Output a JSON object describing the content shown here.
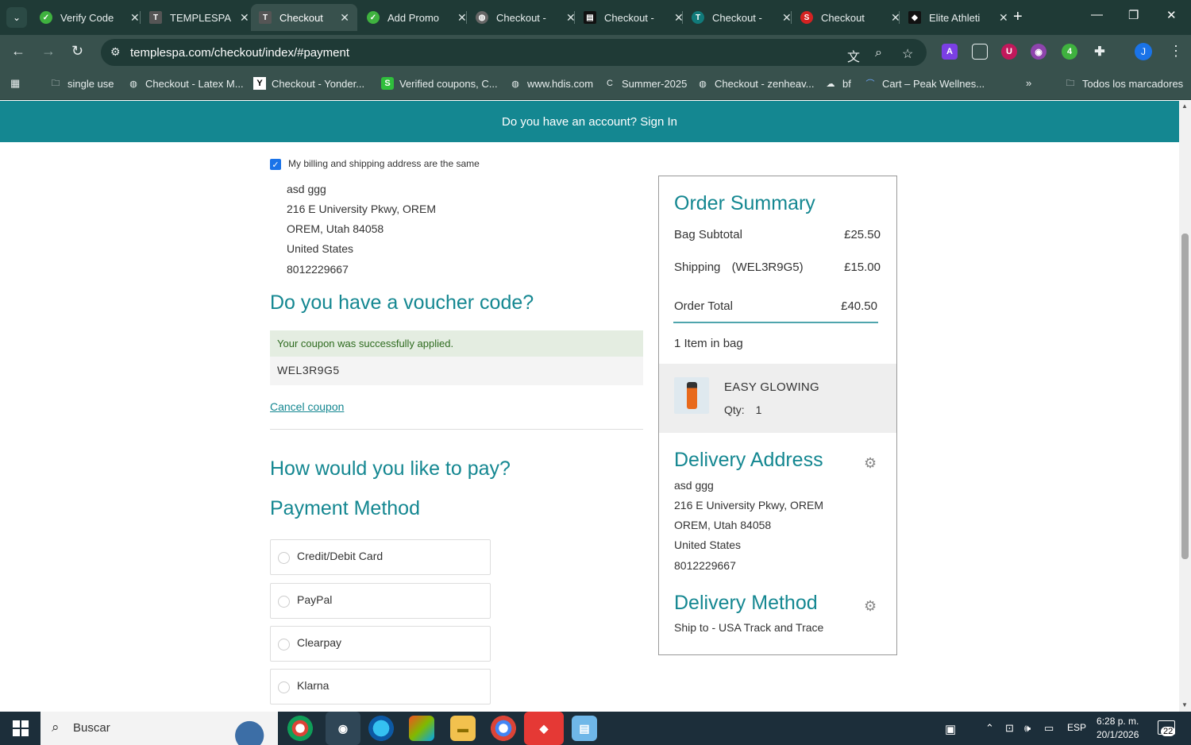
{
  "tabs": [
    {
      "title": "Verify Code",
      "icon": "verify-icon",
      "color": "#3fb23f"
    },
    {
      "title": "TEMPLESPA",
      "icon": "templespa-icon",
      "color": "#555"
    },
    {
      "title": "Checkout",
      "icon": "templespa-icon",
      "color": "#555",
      "active": true
    },
    {
      "title": "Add Promo",
      "icon": "promo-icon",
      "color": "#3fb23f"
    },
    {
      "title": "Checkout -",
      "icon": "globe-icon",
      "color": "#666"
    },
    {
      "title": "Checkout -",
      "icon": "site-icon",
      "color": "#111"
    },
    {
      "title": "Checkout -",
      "icon": "tsi-icon",
      "color": "#117a7a"
    },
    {
      "title": "Checkout",
      "icon": "s-icon",
      "color": "#d32222"
    },
    {
      "title": "Elite Athleti",
      "icon": "elite-icon",
      "color": "#111"
    }
  ],
  "address_bar": {
    "url": "templespa.com/checkout/index/#payment"
  },
  "bookmarks": [
    {
      "label": "single use",
      "icon": "folder-icon"
    },
    {
      "label": "Checkout - Latex M...",
      "icon": "globe-icon"
    },
    {
      "label": "Checkout - Yonder...",
      "icon": "y-icon"
    },
    {
      "label": "Verified coupons, C...",
      "icon": "s-green-icon"
    },
    {
      "label": "www.hdis.com",
      "icon": "globe-icon"
    },
    {
      "label": "Summer-2025",
      "icon": "c-icon"
    },
    {
      "label": "Checkout - zenheav...",
      "icon": "globe-icon"
    },
    {
      "label": "bf",
      "icon": "cloud-icon"
    },
    {
      "label": "Cart – Peak Wellnes...",
      "icon": "peak-icon"
    },
    {
      "label": "Todos los marcadores",
      "icon": "folder-icon"
    }
  ],
  "banner": {
    "text": "Do you have an account? Sign In"
  },
  "billing": {
    "same_address_label": "My billing and shipping address are the same",
    "name": "asd ggg",
    "street": "216 E University Pkwy, OREM",
    "city": "OREM, Utah 84058",
    "country": "United States",
    "phone": "8012229667"
  },
  "voucher": {
    "heading": "Do you have a voucher code?",
    "success_message": "Your coupon was successfully applied.",
    "code": "WEL3R9G5",
    "cancel_label": "Cancel coupon"
  },
  "payment": {
    "heading": "How would you like to pay?",
    "method_heading": "Payment Method",
    "options": [
      "Credit/Debit Card",
      "PayPal",
      "Clearpay",
      "Klarna"
    ]
  },
  "summary": {
    "heading": "Order Summary",
    "subtotal_label": "Bag Subtotal",
    "subtotal_value": "£25.50",
    "shipping_label": "Shipping",
    "shipping_code": "(WEL3R9G5)",
    "shipping_value": "£15.00",
    "total_label": "Order Total",
    "total_value": "£40.50",
    "items_count": "1 Item in bag",
    "item": {
      "name": "EASY GLOWING",
      "qty_label": "Qty:",
      "qty": "1"
    },
    "delivery_address_heading": "Delivery Address",
    "delivery_address": {
      "name": "asd ggg",
      "street": "216 E University Pkwy, OREM",
      "city": "OREM, Utah 84058",
      "country": "United States",
      "phone": "8012229667"
    },
    "delivery_method_heading": "Delivery Method",
    "delivery_method": "Ship to - USA Track and Trace"
  },
  "taskbar": {
    "search_placeholder": "Buscar",
    "language": "ESP",
    "time": "6:28 p. m.",
    "date": "20/1/2026",
    "notifications": "22"
  },
  "colors": {
    "brand_teal": "#148791",
    "chrome_dark": "#1f3a36",
    "chrome": "#38514d"
  }
}
